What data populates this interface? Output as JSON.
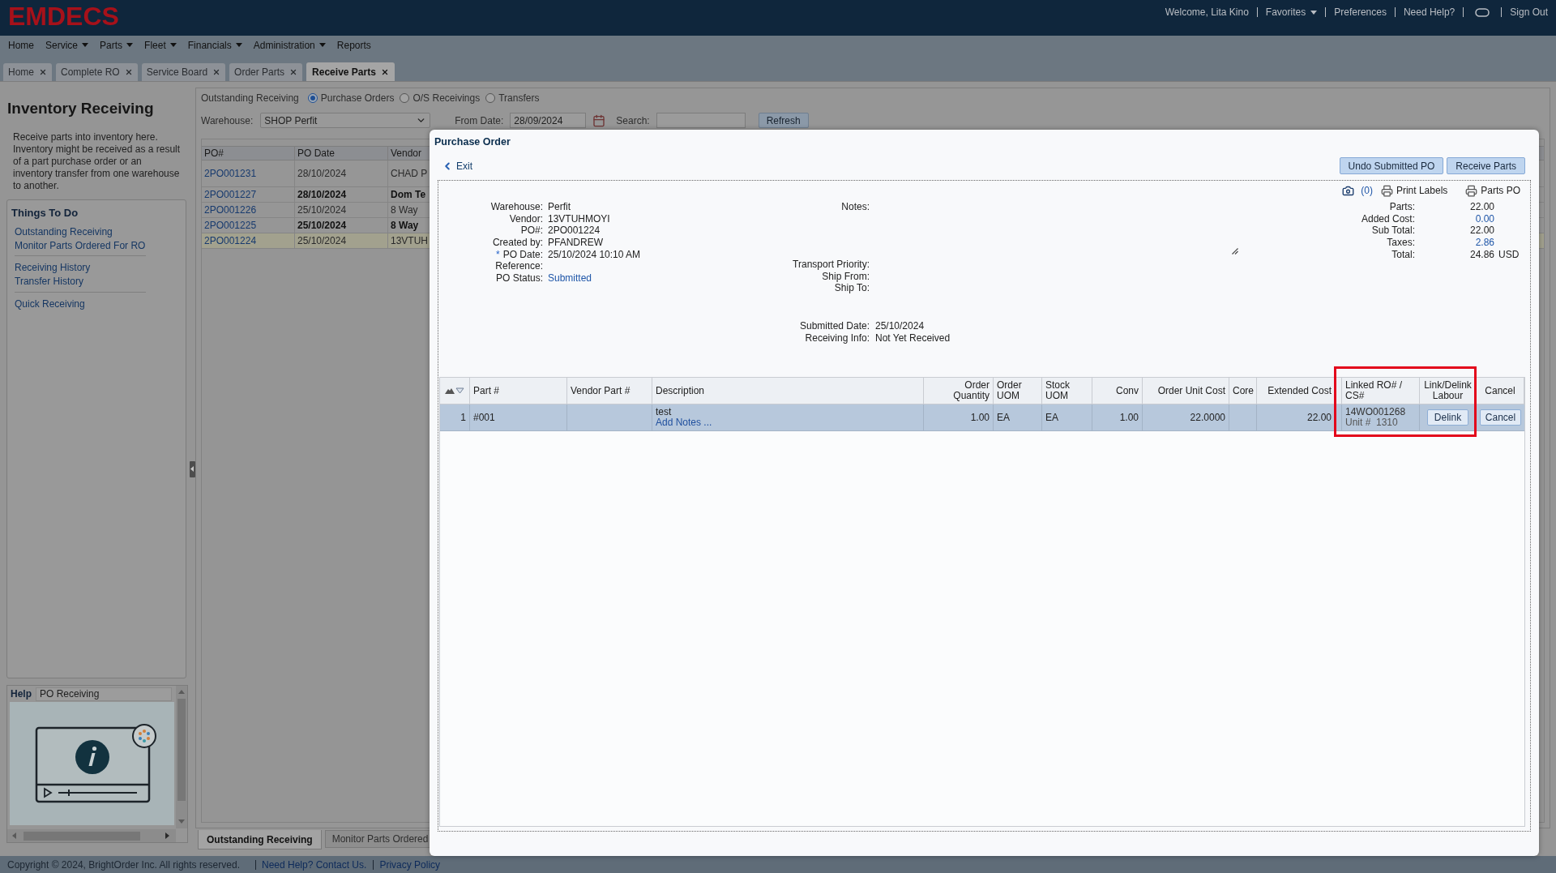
{
  "header": {
    "logo": "EMDECS",
    "links": [
      {
        "kind": "text",
        "label": "Welcome, Lita Kino"
      },
      {
        "kind": "dropdown",
        "label": "Favorites"
      },
      {
        "kind": "link",
        "label": "Preferences"
      },
      {
        "kind": "link",
        "label": "Need Help?"
      },
      {
        "kind": "icon"
      },
      {
        "kind": "link",
        "label": "Sign Out"
      }
    ]
  },
  "menu": [
    {
      "label": "Home",
      "dropdown": false
    },
    {
      "label": "Service",
      "dropdown": true
    },
    {
      "label": "Parts",
      "dropdown": true
    },
    {
      "label": "Fleet",
      "dropdown": true
    },
    {
      "label": "Financials",
      "dropdown": true
    },
    {
      "label": "Administration",
      "dropdown": true
    },
    {
      "label": "Reports",
      "dropdown": false
    }
  ],
  "tabs": [
    {
      "label": "Home",
      "selected": false
    },
    {
      "label": "Complete RO",
      "selected": false
    },
    {
      "label": "Service Board",
      "selected": false
    },
    {
      "label": "Order Parts",
      "selected": false
    },
    {
      "label": "Receive Parts",
      "selected": true
    }
  ],
  "sidebar": {
    "title": "Inventory Receiving",
    "description": "Receive parts into inventory here. Inventory might be received as a result of a part purchase order or an inventory transfer from one warehouse to another.",
    "things_to_do": {
      "title": "Things To Do",
      "groups": [
        [
          "Outstanding Receiving",
          "Monitor Parts Ordered For RO"
        ],
        [
          "Receiving History",
          "Transfer History"
        ],
        [
          "Quick Receiving"
        ]
      ]
    },
    "help": {
      "title": "Help",
      "topic": "PO Receiving"
    }
  },
  "receiving": {
    "filter": {
      "label": "Outstanding Receiving",
      "options": [
        {
          "label": "Purchase Orders",
          "selected": true
        },
        {
          "label": "O/S Receivings",
          "selected": false
        },
        {
          "label": "Transfers",
          "selected": false
        }
      ]
    },
    "warehouse": {
      "label": "Warehouse:",
      "value": "SHOP Perfit"
    },
    "from_date": {
      "label": "From Date:",
      "value": "28/09/2024"
    },
    "search": {
      "label": "Search:"
    },
    "refresh": "Refresh",
    "list": {
      "columns": [
        "PO#",
        "PO Date",
        "Vendor"
      ],
      "rows": [
        {
          "po": "2PO001231",
          "date": "28/10/2024",
          "vendor": "CHAD P",
          "bold": false,
          "selected": false
        },
        {
          "po": "2PO001227",
          "date": "28/10/2024",
          "vendor": "Dom Te",
          "bold": true,
          "selected": false
        },
        {
          "po": "2PO001226",
          "date": "25/10/2024",
          "vendor": "8 Way",
          "bold": false,
          "selected": false
        },
        {
          "po": "2PO001225",
          "date": "25/10/2024",
          "vendor": "8 Way",
          "bold": true,
          "selected": false
        },
        {
          "po": "2PO001224",
          "date": "25/10/2024",
          "vendor": "13VTUH",
          "bold": false,
          "selected": true
        }
      ]
    },
    "bottom_tabs": [
      {
        "label": "Outstanding Receiving",
        "selected": true
      },
      {
        "label": "Monitor Parts Ordered",
        "selected": false
      }
    ]
  },
  "purchase_order": {
    "title": "Purchase Order",
    "exit": "Exit",
    "actions": [
      "Undo Submitted PO",
      "Receive Parts"
    ],
    "attachments": "(0)",
    "print": [
      "Print Labels",
      "Parts PO"
    ],
    "details": [
      {
        "label": "Warehouse:",
        "value": "Perfit",
        "link": false
      },
      {
        "label": "Vendor:",
        "value": "13VTUHMOYI",
        "link": false
      },
      {
        "label": "PO#:",
        "value": "2PO001224",
        "link": false
      },
      {
        "label": "Created by:",
        "value": "PFANDREW",
        "link": false
      },
      {
        "marker": "*",
        "label": "PO Date:",
        "value": "25/10/2024 10:10 AM",
        "link": false
      },
      {
        "label": "Reference:"
      },
      {
        "label": "PO Status:",
        "value": "Submitted",
        "link": true
      }
    ],
    "notes": {
      "label": "Notes:"
    },
    "shipping": [
      {
        "label": "Transport Priority:"
      },
      {
        "label": "Ship From:"
      },
      {
        "label": "Ship To:"
      }
    ],
    "submission": [
      {
        "label": "Submitted Date:",
        "value": "25/10/2024"
      },
      {
        "label": "Receiving Info:",
        "value": "Not Yet Received"
      }
    ],
    "totals": [
      {
        "label": "Parts:",
        "value": "22.00",
        "link": false
      },
      {
        "label": "Added Cost:",
        "value": "0.00",
        "link": true
      },
      {
        "label": "Sub Total:",
        "value": "22.00",
        "link": false
      },
      {
        "label": "Taxes:",
        "value": "2.86",
        "link": true
      },
      {
        "label": "Total:",
        "value": "24.86",
        "unit": "USD",
        "link": false
      }
    ],
    "lines": {
      "columns": [
        "Part #",
        "Vendor Part #",
        "Description",
        "Order Quantity",
        "Order UOM",
        "Stock UOM",
        "Conv",
        "Order Unit Cost",
        "Core",
        "Extended Cost",
        "Linked RO# / CS#",
        "Link/Delink Labour",
        "Cancel"
      ],
      "rows": [
        {
          "selected": true,
          "line": "1",
          "part": "#001",
          "description": "test",
          "notes_link": "Add Notes ...",
          "order_quantity": "1.00",
          "order_uom": "EA",
          "stock_uom": "EA",
          "conv": "1.00",
          "order_unit_cost": "22.0000",
          "extended_cost": "22.00",
          "linked_ro": "14WO001268",
          "unit": "Unit #  1310",
          "link_action": "Delink",
          "cancel": "Cancel"
        }
      ]
    },
    "annotation": {
      "kind": "frame"
    }
  },
  "footer": {
    "copyright": "Copyright © 2024, BrightOrder Inc. All rights reserved.",
    "links": [
      "Need Help? Contact Us.",
      "Privacy Policy"
    ]
  }
}
